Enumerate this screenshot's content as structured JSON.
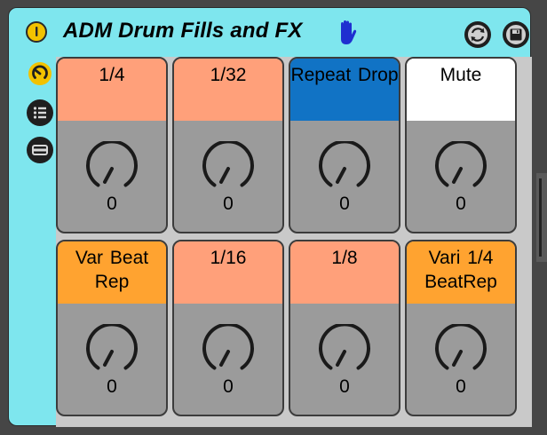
{
  "device": {
    "title": "ADM Drum Fills and FX",
    "colors": {
      "body": "#7ee6ee",
      "power": "#f2c200",
      "hand": "#1f2fd0"
    }
  },
  "icons": {
    "power": "power-icon",
    "hand": "hand-icon",
    "sync": "sync-icon",
    "save": "save-icon",
    "side_1": "macro-knob-icon",
    "side_2": "list-icon",
    "side_3": "panel-icon"
  },
  "cells": [
    {
      "label": "1/4",
      "value": "0",
      "color": "#ffa07a"
    },
    {
      "label": "1/32",
      "value": "0",
      "color": "#ffa07a"
    },
    {
      "label": "Repeat Drop",
      "value": "0",
      "color": "#1173c5"
    },
    {
      "label": "Mute",
      "value": "0",
      "color": "#ffffff"
    },
    {
      "label": "Var Beat Rep",
      "value": "0",
      "color": "#ffa330"
    },
    {
      "label": "1/16",
      "value": "0",
      "color": "#ffa07a"
    },
    {
      "label": "1/8",
      "value": "0",
      "color": "#ffa07a"
    },
    {
      "label": "Vari 1/4 BeatRep",
      "value": "0",
      "color": "#ffa330"
    }
  ]
}
